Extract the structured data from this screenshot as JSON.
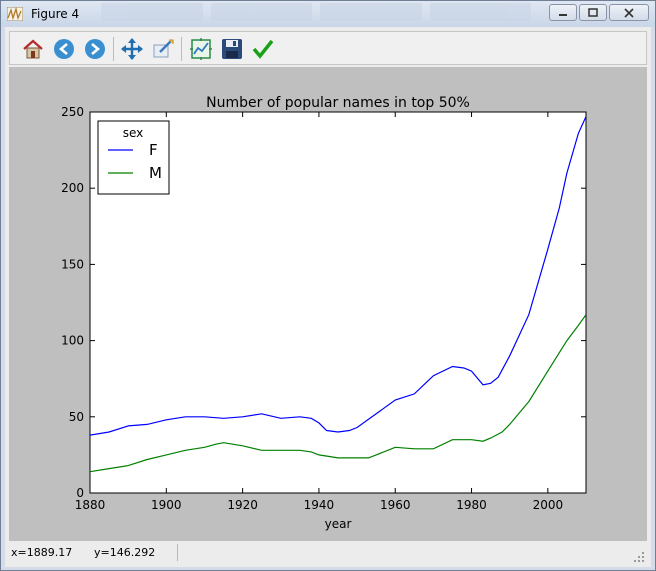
{
  "window": {
    "title": "Figure 4"
  },
  "toolbar": {
    "buttons": [
      {
        "name": "home",
        "icon": "home-icon"
      },
      {
        "name": "back",
        "icon": "back-arrow-icon"
      },
      {
        "name": "forward",
        "icon": "forward-arrow-icon"
      },
      {
        "name": "pan",
        "icon": "pan-arrows-icon"
      },
      {
        "name": "zoom",
        "icon": "zoom-rect-icon"
      },
      {
        "name": "subplots",
        "icon": "subplots-icon"
      },
      {
        "name": "save",
        "icon": "floppy-disk-icon"
      },
      {
        "name": "edit",
        "icon": "checkmark-icon"
      }
    ]
  },
  "status": {
    "x": "x=1889.17",
    "y": "y=146.292"
  },
  "colors": {
    "F": "#0000ff",
    "M": "#008000",
    "canvas_bg": "#bfbfbf",
    "axes_bg": "#ffffff"
  },
  "chart_data": {
    "type": "line",
    "title": "Number of popular names in top 50%",
    "xlabel": "year",
    "ylabel": "",
    "xlim": [
      1880,
      2010
    ],
    "ylim": [
      0,
      250
    ],
    "xticks": [
      1880,
      1900,
      1920,
      1940,
      1960,
      1980,
      2000
    ],
    "yticks": [
      0,
      50,
      100,
      150,
      200,
      250
    ],
    "legend": {
      "title": "sex",
      "placement": "upper-left"
    },
    "series": [
      {
        "name": "F",
        "color": "#0000ff",
        "x": [
          1880,
          1885,
          1890,
          1895,
          1900,
          1905,
          1910,
          1915,
          1920,
          1925,
          1930,
          1935,
          1938,
          1940,
          1942,
          1945,
          1948,
          1950,
          1955,
          1960,
          1965,
          1970,
          1975,
          1978,
          1980,
          1983,
          1985,
          1987,
          1990,
          1995,
          2000,
          2003,
          2005,
          2008,
          2010
        ],
        "y": [
          38,
          40,
          44,
          45,
          48,
          50,
          50,
          49,
          50,
          52,
          49,
          50,
          49,
          46,
          41,
          40,
          41,
          43,
          52,
          61,
          65,
          77,
          83,
          82,
          80,
          71,
          72,
          76,
          90,
          117,
          160,
          187,
          210,
          236,
          247
        ]
      },
      {
        "name": "M",
        "color": "#008000",
        "x": [
          1880,
          1885,
          1890,
          1895,
          1900,
          1905,
          1910,
          1913,
          1915,
          1920,
          1925,
          1930,
          1935,
          1938,
          1940,
          1945,
          1950,
          1953,
          1955,
          1960,
          1965,
          1970,
          1975,
          1980,
          1983,
          1985,
          1988,
          1990,
          1995,
          2000,
          2005,
          2008,
          2010
        ],
        "y": [
          14,
          16,
          18,
          22,
          25,
          28,
          30,
          32,
          33,
          31,
          28,
          28,
          28,
          27,
          25,
          23,
          23,
          23,
          25,
          30,
          29,
          29,
          35,
          35,
          34,
          36,
          40,
          45,
          60,
          80,
          100,
          110,
          117
        ]
      }
    ]
  }
}
